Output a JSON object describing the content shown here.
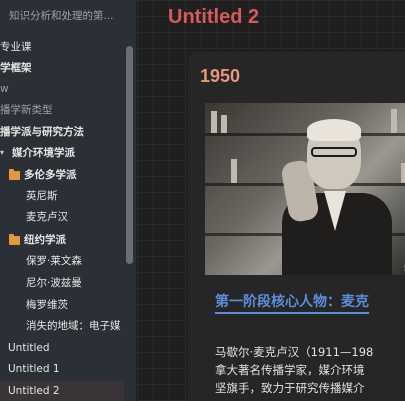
{
  "sidebar": {
    "items": [
      {
        "label": "知识分析和处理的第...",
        "style": "dim"
      },
      {
        "label": "专业课",
        "style": "normal"
      },
      {
        "label": "学框架",
        "style": "bold"
      },
      {
        "label": "w",
        "style": "dim"
      },
      {
        "label": "播学新类型",
        "style": "dim"
      },
      {
        "label": "播学派与研究方法",
        "style": "bold"
      },
      {
        "label": "媒介环境学派",
        "style": "bold"
      },
      {
        "label": "多伦多学派",
        "style": "bold"
      },
      {
        "label": "英尼斯",
        "style": "normal"
      },
      {
        "label": "麦克卢汉",
        "style": "normal"
      },
      {
        "label": "纽约学派",
        "style": "bold"
      },
      {
        "label": "保罗·莱文森",
        "style": "normal"
      },
      {
        "label": "尼尔·波兹曼",
        "style": "normal"
      },
      {
        "label": "梅罗维茨",
        "style": "normal"
      },
      {
        "label": "消失的地域：电子媒",
        "style": "normal"
      },
      {
        "label": "Untitled",
        "style": "normal"
      },
      {
        "label": "Untitled 1",
        "style": "normal"
      },
      {
        "label": "Untitled 2",
        "style": "selected"
      }
    ]
  },
  "main": {
    "title": "Untitled 2",
    "year": "1950",
    "photo_watermark": "知",
    "heading": "第一阶段核心人物：麦克",
    "paragraph": [
      "马歇尔·麦克卢汉（1911—198",
      "拿大著名传播学家，媒介环境",
      "坚旗手，致力于研究传播媒介"
    ]
  },
  "colors": {
    "sidebar_bg": "#2a3036",
    "title": "#d65a5a",
    "year": "#e8967a",
    "heading": "#5b8fdc",
    "folder": "#e8963c"
  }
}
